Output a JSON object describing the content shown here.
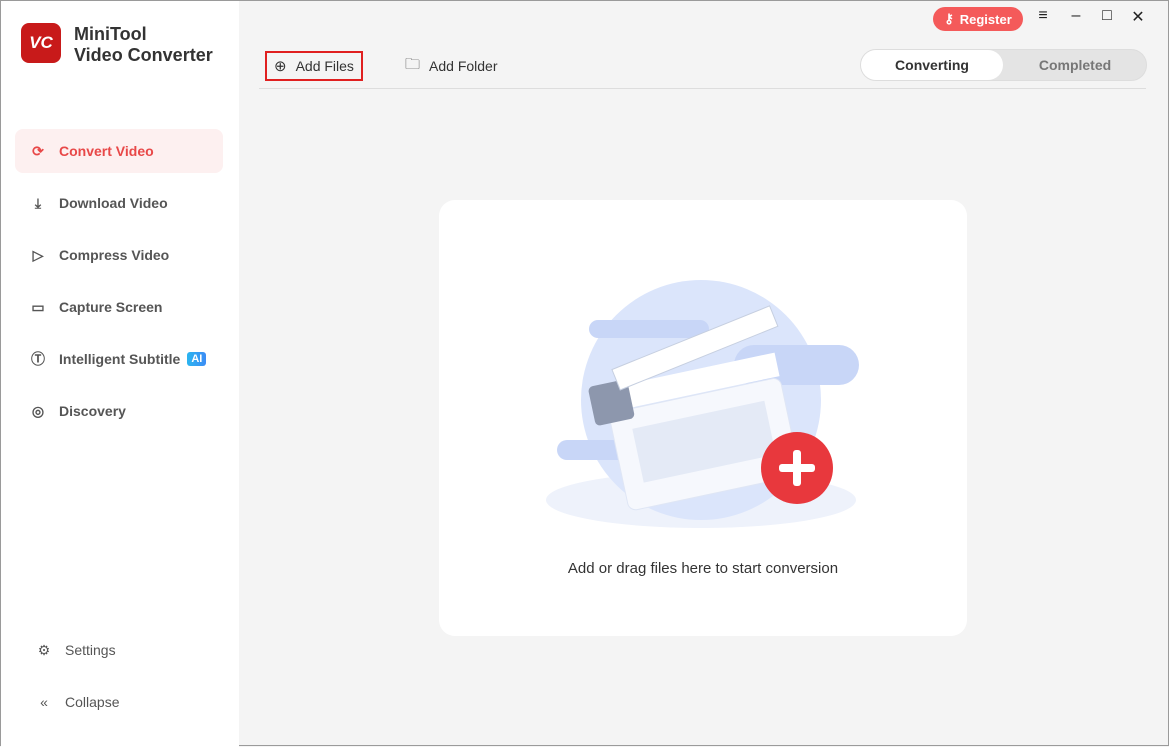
{
  "app": {
    "logo": "VC",
    "name_line1": "MiniTool",
    "name_line2": "Video Converter"
  },
  "sidebar": {
    "items": [
      {
        "label": "Convert Video",
        "icon": "convert-icon"
      },
      {
        "label": "Download Video",
        "icon": "download-icon"
      },
      {
        "label": "Compress Video",
        "icon": "compress-icon"
      },
      {
        "label": "Capture Screen",
        "icon": "camera-icon"
      },
      {
        "label": "Intelligent Subtitle",
        "icon": "subtitle-icon",
        "badge": "AI"
      },
      {
        "label": "Discovery",
        "icon": "compass-icon"
      }
    ],
    "settings": "Settings",
    "collapse": "Collapse"
  },
  "toolbar": {
    "add_files": "Add Files",
    "add_folder": "Add Folder"
  },
  "tabs": {
    "converting": "Converting",
    "completed": "Completed"
  },
  "titlebar": {
    "register": "Register"
  },
  "main": {
    "drop_text": "Add or drag files here to start conversion"
  },
  "colors": {
    "accent": "#e84848",
    "register": "#f45a5a"
  }
}
